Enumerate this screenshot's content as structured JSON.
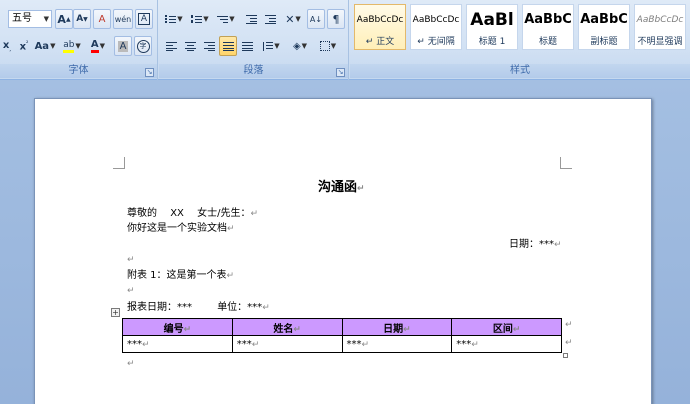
{
  "ribbon": {
    "font_group": {
      "label": "字体",
      "font_size": "五号",
      "grow_font": "A",
      "shrink_font": "A",
      "clear_format": "A",
      "phonetic": "wén",
      "char_border": "A",
      "subscript": "x",
      "superscript": "x",
      "change_case": "Aa",
      "highlight": "ab",
      "font_color": "A",
      "char_shading": "A",
      "enclose": "字",
      "launcher": "↘"
    },
    "paragraph_group": {
      "label": "段落",
      "launcher": "↘",
      "sort": "A↓",
      "show_marks": "¶"
    },
    "styles_group": {
      "label": "样式",
      "items": [
        {
          "sample": "AaBbCcDc",
          "name": "↵ 正文"
        },
        {
          "sample": "AaBbCcDc",
          "name": "↵ 无间隔"
        },
        {
          "sample": "AaBl",
          "name": "标题 1"
        },
        {
          "sample": "AaBbC",
          "name": "标题"
        },
        {
          "sample": "AaBbC",
          "name": "副标题"
        },
        {
          "sample": "AaBbCcDc",
          "name": "不明显强调"
        }
      ]
    },
    "colors": {
      "highlight": "#ffff00",
      "font_color": "#ff0000"
    }
  },
  "document": {
    "title": "沟通函",
    "salutation_prefix": "尊敬的",
    "name_placeholder": "XX",
    "salutation_suffix": "女士/先生：",
    "body_line": "你好这是一个实验文档",
    "date_line": "日期：***",
    "attachment_label": "附表 1：这是第一个表",
    "report_date": "报表日期：***",
    "unit": "单位：***",
    "paragraph_mark": "↵",
    "move_handle": "+",
    "table": {
      "headers": [
        "编号",
        "姓名",
        "日期",
        "区间"
      ],
      "rows": [
        [
          "***",
          "***",
          "***",
          "***"
        ]
      ],
      "header_color": "#cc99ff"
    }
  }
}
